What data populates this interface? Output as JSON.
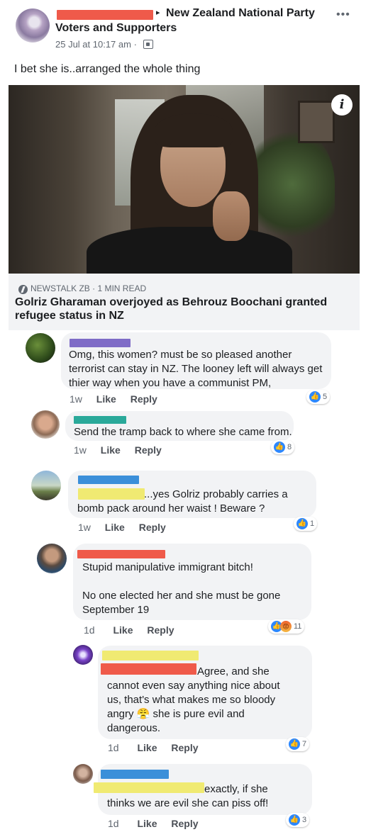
{
  "post": {
    "arrow": "▸",
    "group_name": "New Zealand National Party",
    "group_name_2": "Voters and Supporters",
    "meta": "25 Jul at 10:17 am ·",
    "more": "•••",
    "text": "I bet she is..arranged the whole thing",
    "link": {
      "info_glyph": "i",
      "source": "NEWSTALK ZB · 1 MIN READ",
      "title": "Golriz Gharaman overjoyed as Behrouz Boochani granted refugee status in NZ"
    }
  },
  "comments": [
    {
      "text": "Omg, this women? must be so pleased another terrorist can stay in NZ. The looney left will always get thier way when you have a communist PM,",
      "time": "1w",
      "like": "Like",
      "reply": "Reply",
      "reaction_count": "5"
    },
    {
      "text": "Send the tramp back to where she came from.",
      "time": "1w",
      "like": "Like",
      "reply": "Reply",
      "reaction_count": "8"
    },
    {
      "text": "...yes Golriz probably carries a\nbomb pack around her waist ! Beware ?",
      "time": "1w",
      "like": "Like",
      "reply": "Reply",
      "reaction_count": "1"
    },
    {
      "text": "Stupid manipulative immigrant bitch!\n\nNo one elected her and she must be gone\nSeptember 19",
      "time": "1d",
      "like": "Like",
      "reply": "Reply",
      "reaction_count": "11"
    },
    {
      "text": "Agree, and she\ncannot even say anything nice about\nus, that's what makes me so bloody\nangry 😤 she is pure evil and\ndangerous.",
      "time": "1d",
      "like": "Like",
      "reply": "Reply",
      "reaction_count": "7"
    },
    {
      "text": "exactly, if she\nthinks we are evil she can piss off!",
      "time": "1d",
      "like": "Like",
      "reply": "Reply",
      "reaction_count": "3"
    }
  ],
  "icons": {
    "like": "👍",
    "angry": "😡"
  }
}
